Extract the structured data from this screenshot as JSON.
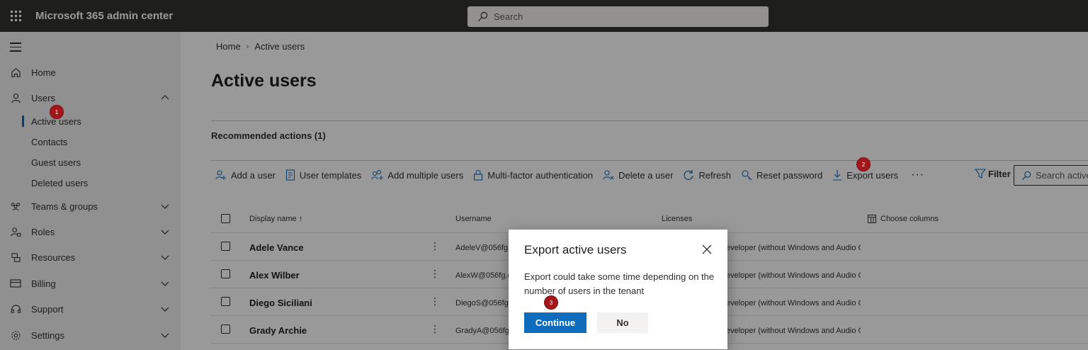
{
  "app": {
    "title": "Microsoft 365 admin center",
    "search_placeholder": "Search"
  },
  "sidebar": {
    "items": [
      {
        "label": "Home",
        "icon": "home-icon"
      },
      {
        "label": "Users",
        "icon": "user-icon"
      },
      {
        "label": "Teams & groups",
        "icon": "teams-icon"
      },
      {
        "label": "Roles",
        "icon": "roles-icon"
      },
      {
        "label": "Resources",
        "icon": "resources-icon"
      },
      {
        "label": "Billing",
        "icon": "billing-icon"
      },
      {
        "label": "Support",
        "icon": "support-icon"
      },
      {
        "label": "Settings",
        "icon": "gear-icon"
      }
    ],
    "users_sub": [
      "Active users",
      "Contacts",
      "Guest users",
      "Deleted users"
    ]
  },
  "breadcrumb": {
    "home": "Home",
    "current": "Active users"
  },
  "page_title": "Active users",
  "recommended": "Recommended actions (1)",
  "toolbar": {
    "add_user": "Add a user",
    "user_templates": "User templates",
    "add_multiple": "Add multiple users",
    "mfa": "Multi-factor authentication",
    "delete_user": "Delete a user",
    "refresh": "Refresh",
    "reset_password": "Reset password",
    "export_users": "Export users",
    "more": "···",
    "filter": "Filter",
    "search_placeholder": "Search active"
  },
  "table": {
    "headers": {
      "display_name": "Display name ↑",
      "username": "Username",
      "licenses": "Licenses",
      "choose_columns": "Choose columns"
    },
    "rows": [
      {
        "name": "Adele Vance",
        "username": "AdeleV@056fg.",
        "license": "eveloper (without Windows and Audio C"
      },
      {
        "name": "Alex Wilber",
        "username": "AlexW@056fg.c",
        "license": "eveloper (without Windows and Audio C"
      },
      {
        "name": "Diego Siciliani",
        "username": "DiegoS@056fg.",
        "license": "eveloper (without Windows and Audio C"
      },
      {
        "name": "Grady Archie",
        "username": "GradyA@056fg",
        "license": "eveloper (without Windows and Audio C"
      }
    ]
  },
  "markers": [
    "1",
    "2",
    "3"
  ],
  "dialog": {
    "title": "Export active users",
    "body": "Export could take some time depending on the number of users in the tenant",
    "continue": "Continue",
    "no": "No"
  },
  "colors": {
    "topbar": "#333230",
    "accent": "#0f6cbd",
    "marker": "#a4161a"
  }
}
